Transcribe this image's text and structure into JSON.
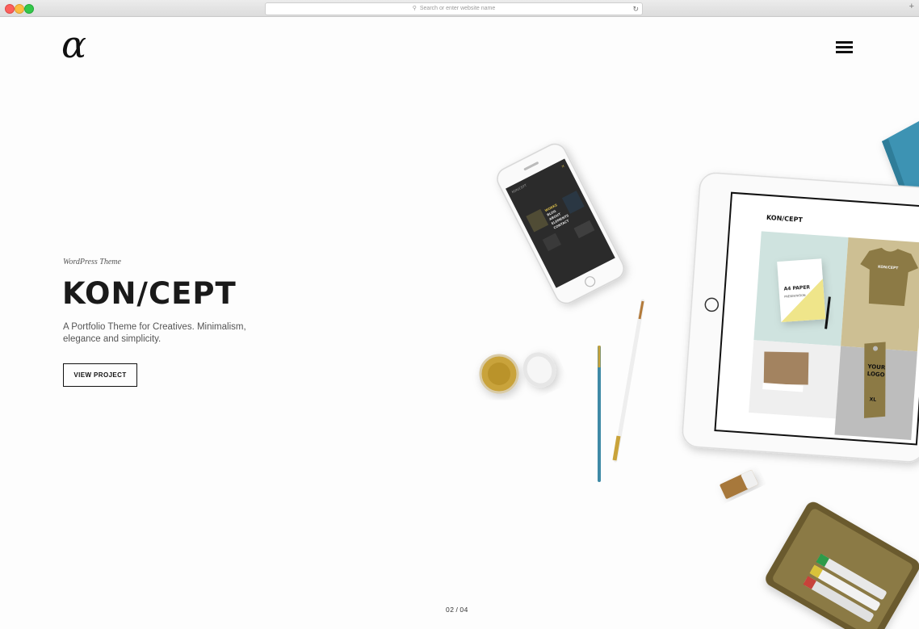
{
  "browser": {
    "address_placeholder": "Search or enter website name"
  },
  "header": {
    "logo_text": "α",
    "menu_icon": "hamburger-icon"
  },
  "hero": {
    "eyebrow": "WordPress Theme",
    "title": "KON/CEPT",
    "subtitle": "A Portfolio Theme for Creatives. Minimalism, elegance and simplicity.",
    "cta_label": "VIEW PROJECT"
  },
  "slider": {
    "current": "02",
    "separator": "/",
    "total": "04"
  },
  "tablet_screen": {
    "brand": "KON/CEPT",
    "paper_label": "A4 PAPER",
    "paper_sub": "PRESENTATION",
    "tshirt_label": "KON/CEPT",
    "tag_line1": "YOUR",
    "tag_line2": "LOGO",
    "tag_size": "XL"
  },
  "phone_screen": {
    "brand": "KON/CEPT",
    "menu_items": [
      "WORKS",
      "BLOG",
      "ABOUT",
      "ELEMENTS",
      "CONTACT"
    ]
  },
  "colors": {
    "accent": "#111111",
    "background": "#fdfdfd",
    "tablet_mint": "#cfe3df",
    "tablet_olive": "#8c7a45",
    "paper_yellow": "#efe58a",
    "book_blue": "#3c93b3"
  }
}
